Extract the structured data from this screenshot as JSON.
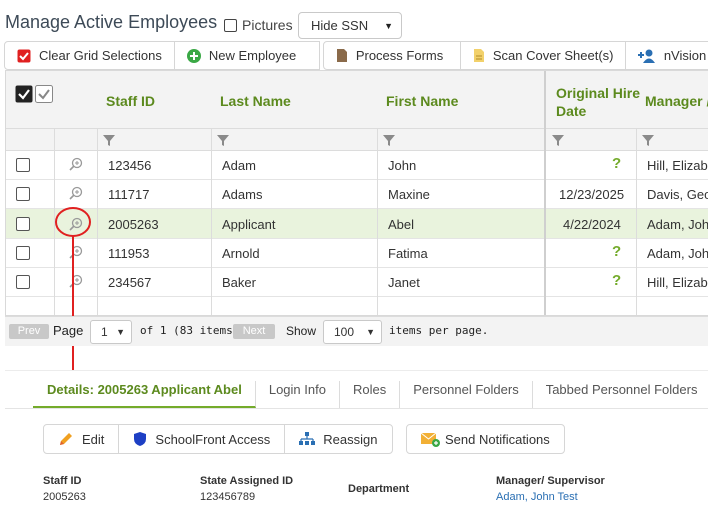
{
  "header": {
    "title": "Manage Active Employees",
    "pictures_label": "Pictures",
    "ssn_select_value": "Hide SSN"
  },
  "toolbar": {
    "buttons": [
      {
        "label": "Clear Grid Selections",
        "icon": "checkbox-red-icon"
      },
      {
        "label": "New Employee",
        "icon": "plus-circle-icon"
      },
      {
        "label": "Process Forms",
        "icon": "document-icon"
      },
      {
        "label": "Scan Cover Sheet(s)",
        "icon": "document-yellow-icon"
      },
      {
        "label": "nVision E",
        "icon": "user-add-icon"
      }
    ]
  },
  "grid": {
    "columns": [
      "Staff ID",
      "Last Name",
      "First Name",
      "Original Hire Date",
      "Manager /"
    ],
    "rows": [
      {
        "staff_id": "123456",
        "last": "Adam",
        "first": "John",
        "hire": "?",
        "manager": "Hill, Elizabe"
      },
      {
        "staff_id": "111717",
        "last": "Adams",
        "first": "Maxine",
        "hire": "12/23/2025",
        "manager": "Davis, Geo"
      },
      {
        "staff_id": "2005263",
        "last": "Applicant",
        "first": "Abel",
        "hire": "4/22/2024",
        "manager": "Adam, John"
      },
      {
        "staff_id": "111953",
        "last": "Arnold",
        "first": "Fatima",
        "hire": "?",
        "manager": "Adam, John"
      },
      {
        "staff_id": "234567",
        "last": "Baker",
        "first": "Janet",
        "hire": "?",
        "manager": "Hill, Elizabe"
      }
    ],
    "selected_row": 2
  },
  "pager": {
    "prev": "Prev",
    "page_label": "Page",
    "page_value": "1",
    "of_text": "of 1 (83 items)",
    "next": "Next",
    "show_label": "Show",
    "per_page_value": "100",
    "per_page_suffix": "items per page."
  },
  "details": {
    "tabs": [
      "Details: 2005263 Applicant Abel",
      "Login Info",
      "Roles",
      "Personnel Folders",
      "Tabbed Personnel Folders"
    ],
    "buttons": {
      "edit": "Edit",
      "schoolfront": "SchoolFront Access",
      "reassign": "Reassign",
      "notify": "Send Notifications"
    },
    "fields": {
      "staff_id_label": "Staff ID",
      "staff_id_value": "2005263",
      "state_id_label": "State Assigned ID",
      "state_id_value": "123456789",
      "department_label": "Department",
      "manager_label": "Manager/ Supervisor",
      "manager_value": "Adam, John Test"
    }
  },
  "colors": {
    "accent_green": "#74ab2b",
    "header_green": "#5c8a1e",
    "annotation_red": "#e02020",
    "link_blue": "#2a6fb3"
  }
}
